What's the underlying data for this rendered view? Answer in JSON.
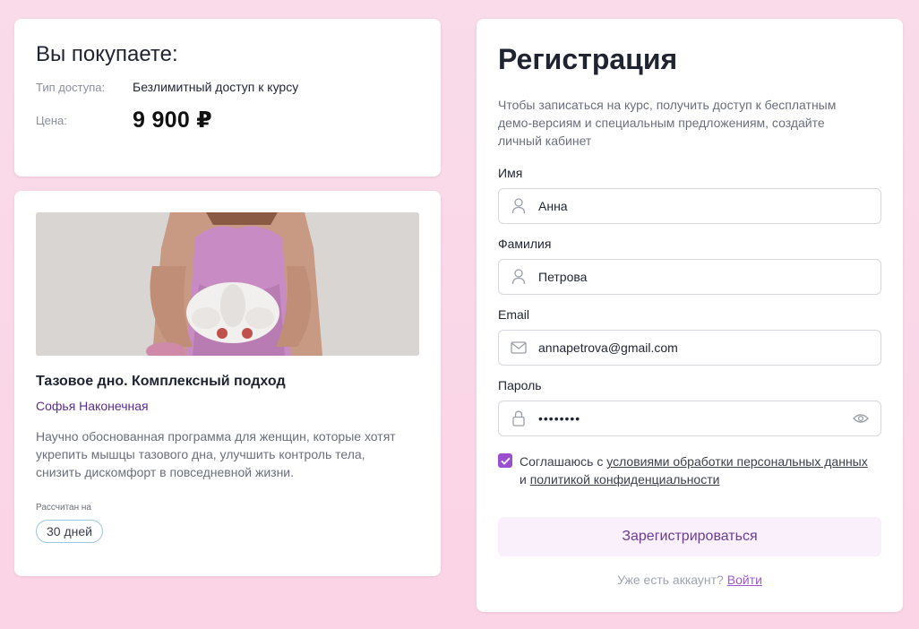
{
  "purchase": {
    "title": "Вы покупаете:",
    "access_label": "Тип доступа:",
    "access_value": "Безлимитный доступ к курсу",
    "price_label": "Цена:",
    "price_value": "9 900 ₽"
  },
  "course": {
    "title": "Тазовое дно. Комплексный подход",
    "author": "Софья Наконечная",
    "description": "Научно обоснованная программа для женщин, которые хотят укрепить мышцы тазового дна, улучшить контроль тела, снизить дискомфорт в повседневной жизни.",
    "duration_label": "Рассчитан на",
    "duration_value": "30 дней"
  },
  "registration": {
    "title": "Регистрация",
    "subtitle": "Чтобы записаться на курс, получить доступ к бесплатным демо-версиям и специальным предложениям, создайте личный кабинет",
    "fields": {
      "first_name": {
        "label": "Имя",
        "value": "Анна",
        "icon": "user-icon"
      },
      "last_name": {
        "label": "Фамилия",
        "value": "Петрова",
        "icon": "user-icon"
      },
      "email": {
        "label": "Email",
        "value": "annapetrova@gmail.com",
        "icon": "mail-icon"
      },
      "password": {
        "label": "Пароль",
        "value": "••••••••",
        "icon": "lock-icon",
        "toggle_icon": "eye-icon"
      }
    },
    "agree": {
      "checked": true,
      "prefix": "Соглашаюсь с",
      "link1": "условиями обработки персональных данных",
      "middle": "и",
      "link2": "политикой конфиденциальности"
    },
    "submit_label": "Зарегистрироваться",
    "login_prompt": "Уже есть аккаунт?",
    "login_link": "Войти"
  },
  "colors": {
    "background": "#fbd4e6",
    "accent": "#9b4fd0",
    "author": "#5b2d8f",
    "button_bg": "#f9f0fb",
    "button_text": "#6a3c92"
  }
}
